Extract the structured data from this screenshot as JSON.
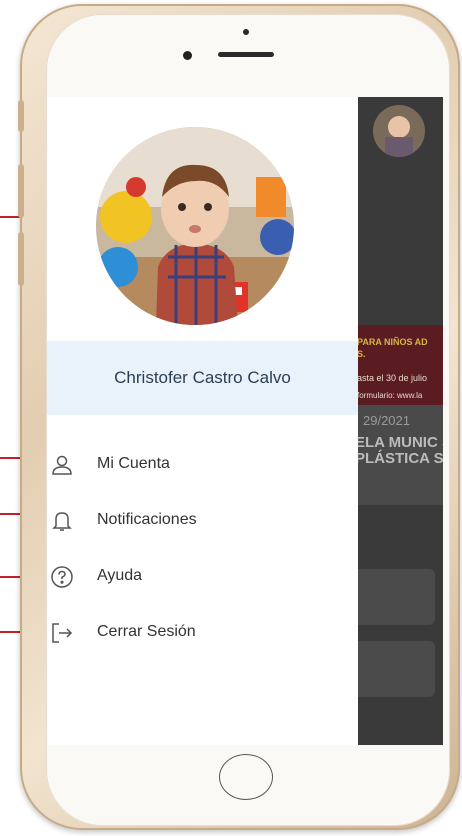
{
  "profile": {
    "name": "Christofer Castro Calvo"
  },
  "menu": {
    "items": [
      {
        "label": "Mi Cuenta",
        "icon": "user-icon"
      },
      {
        "label": "Notificaciones",
        "icon": "bell-icon"
      },
      {
        "label": "Ayuda",
        "icon": "help-icon"
      },
      {
        "label": "Cerrar Sesión",
        "icon": "logout-icon"
      }
    ]
  },
  "background_app": {
    "banner_line1": "PARA NIÑOS AD",
    "banner_line2": "S.",
    "banner_line3": "asta el 30 de julio",
    "banner_line4": "formulario: www.la",
    "date": "29/2021",
    "title": "ELA MUNIC S PLÁSTICA S"
  },
  "colors": {
    "accent_pointer": "#c61f2c",
    "name_bar": "#e9f2fa",
    "name_text": "#2c3e55"
  }
}
